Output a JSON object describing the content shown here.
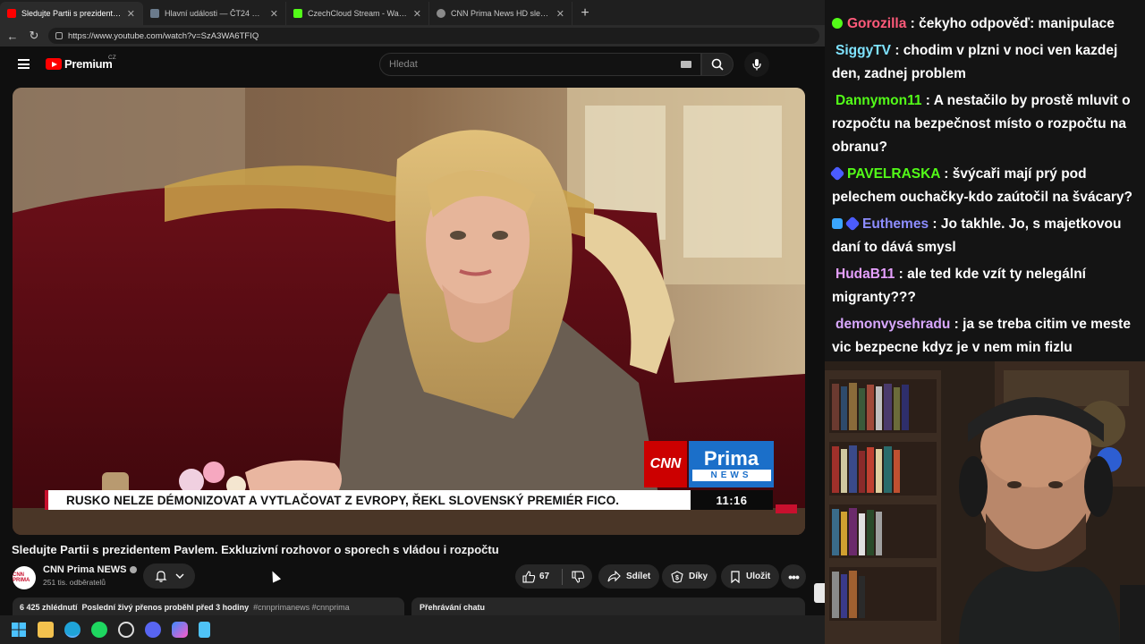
{
  "browser": {
    "tabs": [
      {
        "title": "Sledujte Partii s prezidentem Pavle",
        "favicon": "youtube-icon",
        "color": "#ff0000",
        "active": true
      },
      {
        "title": "Hlavní události — ČT24 — Česká",
        "favicon": "ct24-icon",
        "color": "#6b7b8c",
        "active": false
      },
      {
        "title": "CzechCloud Stream - Watch Live o",
        "favicon": "kick-icon",
        "color": "#53fc18",
        "active": false
      },
      {
        "title": "CNN Prima News HD sledujte onl",
        "favicon": "globe-icon",
        "color": "#8a8a8a",
        "active": false
      }
    ],
    "url": "https://www.youtube.com/watch?v=SzA3WA6TFIQ"
  },
  "youtube": {
    "logo_text": "Premium",
    "region": "CZ",
    "search_placeholder": "Hledat"
  },
  "video": {
    "lower_third": "RUSKO NELZE DÉMONIZOVAT A VYTLAČOVAT Z EVROPY, ŘEKL SLOVENSKÝ PREMIÉR FICO.",
    "clock": "11:16",
    "cnn_logo": "CNN",
    "prima_logo": "Prima",
    "news_logo": "NEWS",
    "title": "Sledujte Partii s prezidentem Pavlem. Exkluzivní rozhovor o sporech s vládou i rozpočtu",
    "channel": "CNN Prima NEWS",
    "avatar_text": "CNN PRIMA",
    "subscribers": "251 tis. odběratelů",
    "likes": "67",
    "share": "Sdílet",
    "thanks": "Díky",
    "save": "Uložit",
    "views": "6 425 zhlédnutí",
    "stream_info": "Poslední živý přenos proběhl před 3 hodiny",
    "hashtags": "#cnnprimanews #cnnprima",
    "chat_replay": "Přehrávání chatu"
  },
  "chat": {
    "messages": [
      {
        "user": "Gorozilla",
        "color": "#ff5a7a",
        "badge": "#53fc18",
        "text": "čekyho odpověď: manipulace"
      },
      {
        "user": "SiggyTV",
        "color": "#7fe3ff",
        "badge": "",
        "text": "chodim v plzni v noci ven kazdej den, zadnej problem"
      },
      {
        "user": "Dannymon11",
        "color": "#53fc18",
        "badge": "",
        "text": "A nestačilo by prostě mluvit o rozpočtu na bezpečnost místo o rozpočtu na obranu?"
      },
      {
        "user": "PAVELRASKA",
        "color": "#53fc18",
        "badge": "#4b5cff",
        "text": "švýcaři mají prý pod pelechem ouchačky-kdo zaútočil na švácary?"
      },
      {
        "user": "Euthemes",
        "color": "#8d8dff",
        "badge": "#4b5cff",
        "text": "Jo takhle. Jo, s majetkovou daní to dává smysl"
      },
      {
        "user": "HudaB11",
        "color": "#e6a0ff",
        "badge": "",
        "text": "ale ted kde vzít ty nelegální migranty???"
      },
      {
        "user": "demonvysehradu",
        "color": "#d9a8ff",
        "badge": "",
        "text": "ja se treba citim ve meste vic bezpecne kdyz je v nem min fizlu"
      }
    ]
  },
  "taskbar": {
    "icons": [
      "windows-start-icon",
      "file-explorer-icon",
      "edge-icon",
      "spotify-icon",
      "obs-icon",
      "discord-icon",
      "copilot-icon",
      "notepad-icon"
    ]
  }
}
